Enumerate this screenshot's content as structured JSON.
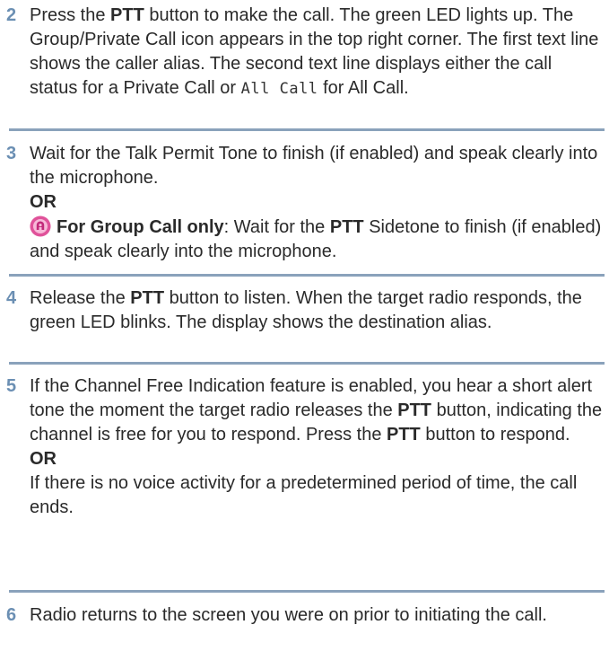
{
  "steps": [
    {
      "num": "2",
      "parts": {
        "a": "Press the ",
        "b": "PTT",
        "c": " button to make the call. The green LED lights up. The Group/Private Call icon appears in the top right corner. The first text line shows the caller alias. The second text line displays either the call status for a Private Call or ",
        "mono": "All Call",
        "d": " for All Call."
      }
    },
    {
      "num": "3",
      "text1": "Wait for the Talk Permit Tone to finish (if enabled) and speak clearly into the microphone.",
      "or": "OR",
      "group_bold": "For Group Call only",
      "group_a": ": Wait for the ",
      "group_ptt": "PTT",
      "group_b": " Sidetone to finish (if enabled) and speak clearly into the microphone."
    },
    {
      "num": "4",
      "a": "Release the ",
      "b": "PTT",
      "c": " button to listen. When the target radio responds, the green LED blinks. The display shows the destination alias."
    },
    {
      "num": "5",
      "a": "If the Channel Free Indication feature is enabled, you hear a short alert tone the moment the target radio releases the ",
      "b": "PTT",
      "c": " button, indicating the channel is free for you to respond. Press the ",
      "d": "PTT",
      "e": " button to respond.",
      "or": "OR",
      "f": "If there is no voice activity for a predetermined period of time, the call ends."
    },
    {
      "num": "6",
      "text": "Radio returns to the screen you were on prior to initiating the call."
    }
  ],
  "colors": {
    "step_number": "#6b8fb3",
    "rule": "#8aa2bb",
    "icon_outer": "#e0529a",
    "icon_inner": "#f7b9d8"
  },
  "icons": {
    "group_call": "group-call-icon"
  }
}
